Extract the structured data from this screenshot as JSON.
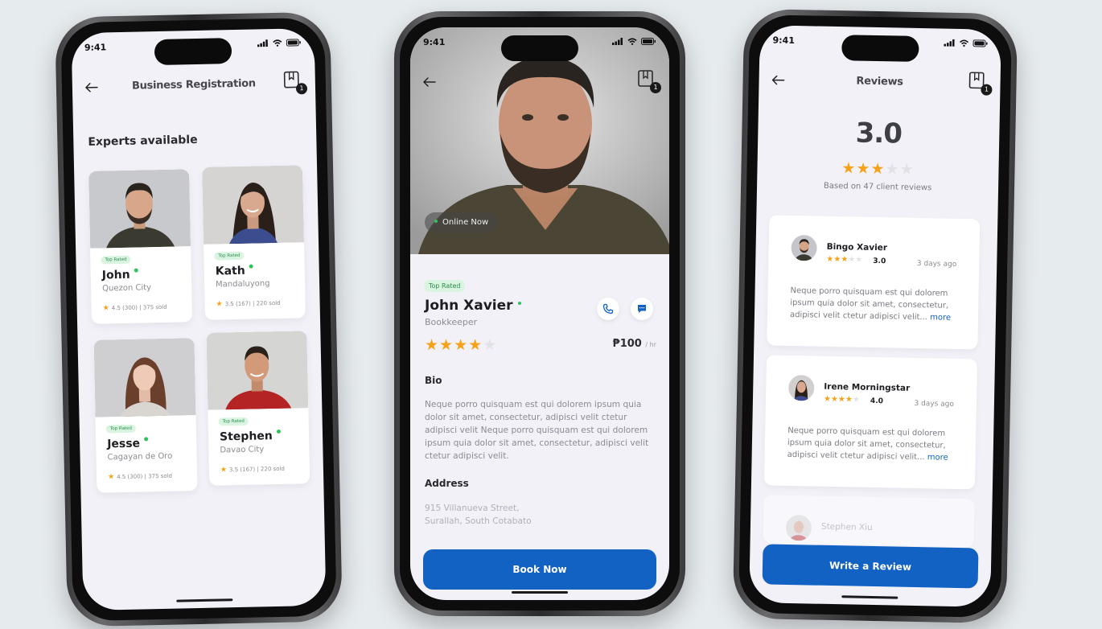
{
  "status_bar": {
    "time": "9:41"
  },
  "bookmark_count": "1",
  "screen1": {
    "title": "Business Registration",
    "section_title": "Experts available",
    "experts": [
      {
        "tag": "Top Rated",
        "name": "John",
        "city": "Quezon City",
        "rating": "4.5 (300)",
        "sold": "375 sold"
      },
      {
        "tag": "Top Rated",
        "name": "Kath",
        "city": "Mandaluyong",
        "rating": "3.5 (167)",
        "sold": "220 sold"
      },
      {
        "tag": "Top Rated",
        "name": "Jesse",
        "city": "Cagayan de Oro",
        "rating": "4.5 (300)",
        "sold": "375 sold"
      },
      {
        "tag": "Top Rated",
        "name": "Stephen",
        "city": "Davao City",
        "rating": "3.5 (167)",
        "sold": "220 sold"
      }
    ]
  },
  "screen2": {
    "online_status": "Online Now",
    "tag": "Top Rated",
    "name": "John Xavier",
    "role": "Bookkeeper",
    "stars": 4,
    "price": "₱100",
    "price_unit": "/ hr",
    "bio_title": "Bio",
    "bio": "Neque porro quisquam est qui dolorem ipsum quia dolor sit amet, consectetur, adipisci velit ctetur adipisci velit Neque porro quisquam est qui dolorem ipsum quia dolor sit amet, consectetur, adipisci velit ctetur adipisci velit.",
    "address_title": "Address",
    "address_line1": "915 Villanueva Street,",
    "address_line2": "Surallah, South Cotabato",
    "book_button": "Book Now"
  },
  "screen3": {
    "title": "Reviews",
    "rating": "3.0",
    "stars": 3,
    "based_on": "Based on 47 client reviews",
    "reviews": [
      {
        "name": "Bingo Xavier",
        "score": "3.0",
        "stars": 3,
        "date": "3 days ago",
        "text": "Neque porro quisquam est qui dolorem ipsum quia dolor sit amet, consectetur, adipisci velit ctetur adipisci velit...",
        "more": "more"
      },
      {
        "name": "Irene Morningstar",
        "score": "4.0",
        "stars": 4,
        "date": "3 days ago",
        "text": "Neque porro quisquam est qui dolorem ipsum quia dolor sit amet, consectetur, adipisci velit ctetur adipisci velit...",
        "more": "more"
      },
      {
        "name": "Stephen Xiu"
      }
    ],
    "write_button": "Write a Review"
  }
}
